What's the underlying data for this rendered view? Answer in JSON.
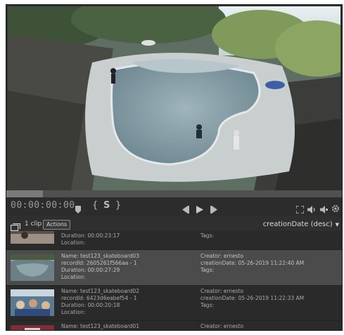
{
  "player": {
    "timecode": "00:00:00:00",
    "progress_fraction": 0.11,
    "icons": {
      "marker": "marker-icon",
      "mark_in": "mark-in-icon",
      "subclip": "subclip-icon",
      "mark_out": "mark-out-icon",
      "step_back": "step-back-icon",
      "play": "play-icon",
      "step_forward": "step-forward-icon",
      "fullscreen": "fullscreen-icon",
      "volume": "volume-icon",
      "audio": "audio-icon",
      "settings": "gear-icon"
    },
    "subclip_label": "S",
    "mark_in_label": "{",
    "mark_out_label": "}"
  },
  "clipbar": {
    "count": "1 clip",
    "actions_label": "Actions",
    "sort_label": "creationDate (desc)",
    "sort_caret": "▼"
  },
  "clips": [
    {
      "duration": "Duration: 00:00:23:17",
      "location": "Location:",
      "tags": "Tags:"
    },
    {
      "name": "Name: test123_skateboard03",
      "record_id": "recordId: 2605261f566aa - 1",
      "duration": "Duration: 00:00:27:29",
      "location": "Location:",
      "creator": "Creator: ernesto",
      "creation_date": "creationDate: 05-26-2019 11:22:40 AM",
      "tags": "Tags:"
    },
    {
      "name": "Name: test123_skateboard02",
      "record_id": "recordId: 6423d6eabef54 - 1",
      "duration": "Duration: 00:00:20:18",
      "location": "Location:",
      "creator": "Creator: ernesto",
      "creation_date": "creationDate: 05-26-2019 11:22:33 AM",
      "tags": "Tags:"
    },
    {
      "name": "Name: test123_skateboard01",
      "creator": "Creator: ernesto"
    }
  ]
}
